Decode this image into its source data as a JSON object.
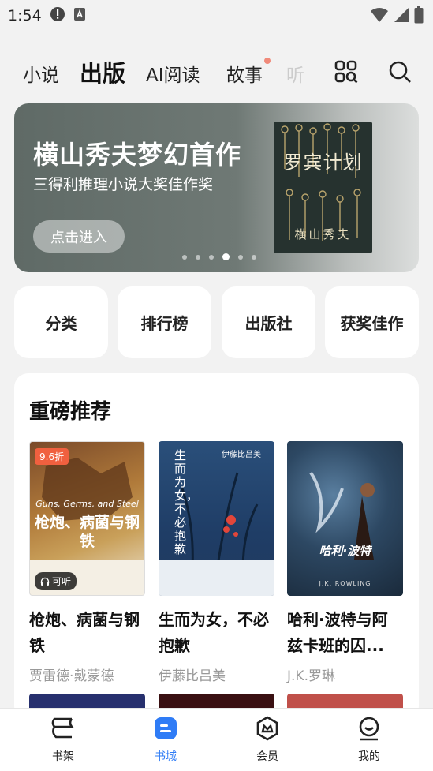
{
  "status": {
    "time": "1:54"
  },
  "nav": {
    "tabs": [
      {
        "label": "小说"
      },
      {
        "label": "出版",
        "active": true
      },
      {
        "label": "AI阅读"
      },
      {
        "label": "故事"
      },
      {
        "label": "听"
      }
    ]
  },
  "banner": {
    "title": "横山秀夫梦幻首作",
    "subtitle": "三得利推理小说大奖佳作奖",
    "button": "点击进入",
    "cover_title": "罗宾计划",
    "cover_author": "横山秀夫",
    "page_count": 6,
    "active_index": 3
  },
  "quick": [
    {
      "label": "分类"
    },
    {
      "label": "排行榜"
    },
    {
      "label": "出版社"
    },
    {
      "label": "获奖佳作"
    }
  ],
  "recommend": {
    "title": "重磅推荐",
    "books": [
      {
        "name": "枪炮、病菌与钢铁",
        "author": "贾雷德·戴蒙德",
        "badge": "9.6折",
        "tag": "可听",
        "cover_text": "枪炮、病菌与钢铁",
        "cover_subtext": "Guns, Germs, and Steel"
      },
      {
        "name": "生而为女，不必抱歉",
        "author": "伊藤比吕美",
        "cover_text": "生而为女，不必抱歉",
        "cover_subtext": "伊藤比吕美"
      },
      {
        "name": "哈利·波特与阿兹卡班的囚...",
        "author": "J.K.罗琳",
        "cover_text": "哈利·波特",
        "cover_subtext": "J.K. ROWLING"
      }
    ]
  },
  "bottom_nav": [
    {
      "label": "书架",
      "icon": "bookshelf-icon"
    },
    {
      "label": "书城",
      "icon": "bookstore-icon",
      "active": true
    },
    {
      "label": "会员",
      "icon": "member-icon"
    },
    {
      "label": "我的",
      "icon": "profile-icon"
    }
  ],
  "colors": {
    "accent": "#2f7cf6",
    "badge": "#f0603f",
    "dot": "#f08a7a"
  }
}
